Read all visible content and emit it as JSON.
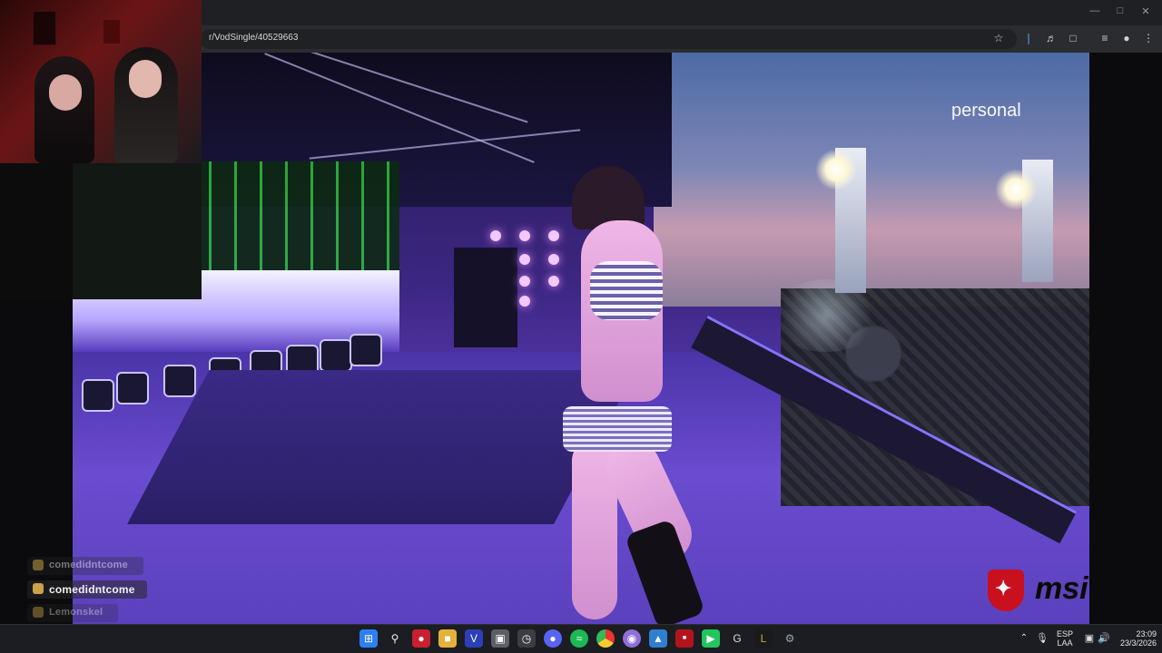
{
  "browser": {
    "url": "r/VodSingle/40529663"
  },
  "video": {
    "watermark": "personal",
    "sponsor_logo": "msi"
  },
  "chat": {
    "messages": [
      {
        "user": "comedidntcome"
      },
      {
        "user": "comedidntcome"
      },
      {
        "user": "Lemonskel"
      }
    ]
  },
  "taskbar": {
    "apps": [
      "windows-start",
      "search",
      "app-red",
      "file-explorer",
      "app-v",
      "app-gallery",
      "app-clock",
      "discord",
      "spotify",
      "chrome",
      "app-shell",
      "photos",
      "app-stream",
      "app-green",
      "app-g",
      "app-league",
      "settings"
    ],
    "language": "ESP",
    "layout": "LAA",
    "time": "23:09",
    "date": "23/3/2026"
  }
}
